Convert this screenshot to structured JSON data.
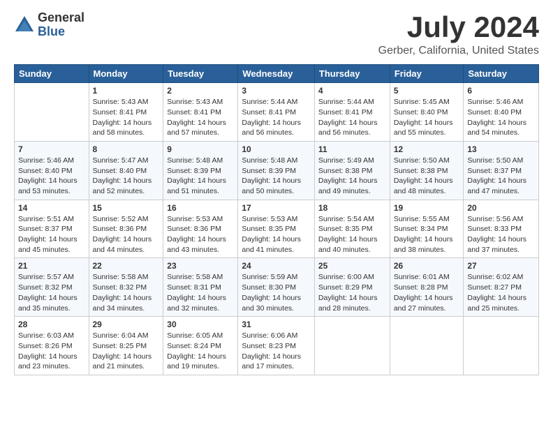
{
  "logo": {
    "general": "General",
    "blue": "Blue"
  },
  "title": "July 2024",
  "subtitle": "Gerber, California, United States",
  "days_of_week": [
    "Sunday",
    "Monday",
    "Tuesday",
    "Wednesday",
    "Thursday",
    "Friday",
    "Saturday"
  ],
  "weeks": [
    [
      {
        "day": "",
        "info": ""
      },
      {
        "day": "1",
        "info": "Sunrise: 5:43 AM\nSunset: 8:41 PM\nDaylight: 14 hours\nand 58 minutes."
      },
      {
        "day": "2",
        "info": "Sunrise: 5:43 AM\nSunset: 8:41 PM\nDaylight: 14 hours\nand 57 minutes."
      },
      {
        "day": "3",
        "info": "Sunrise: 5:44 AM\nSunset: 8:41 PM\nDaylight: 14 hours\nand 56 minutes."
      },
      {
        "day": "4",
        "info": "Sunrise: 5:44 AM\nSunset: 8:41 PM\nDaylight: 14 hours\nand 56 minutes."
      },
      {
        "day": "5",
        "info": "Sunrise: 5:45 AM\nSunset: 8:40 PM\nDaylight: 14 hours\nand 55 minutes."
      },
      {
        "day": "6",
        "info": "Sunrise: 5:46 AM\nSunset: 8:40 PM\nDaylight: 14 hours\nand 54 minutes."
      }
    ],
    [
      {
        "day": "7",
        "info": "Sunrise: 5:46 AM\nSunset: 8:40 PM\nDaylight: 14 hours\nand 53 minutes."
      },
      {
        "day": "8",
        "info": "Sunrise: 5:47 AM\nSunset: 8:40 PM\nDaylight: 14 hours\nand 52 minutes."
      },
      {
        "day": "9",
        "info": "Sunrise: 5:48 AM\nSunset: 8:39 PM\nDaylight: 14 hours\nand 51 minutes."
      },
      {
        "day": "10",
        "info": "Sunrise: 5:48 AM\nSunset: 8:39 PM\nDaylight: 14 hours\nand 50 minutes."
      },
      {
        "day": "11",
        "info": "Sunrise: 5:49 AM\nSunset: 8:38 PM\nDaylight: 14 hours\nand 49 minutes."
      },
      {
        "day": "12",
        "info": "Sunrise: 5:50 AM\nSunset: 8:38 PM\nDaylight: 14 hours\nand 48 minutes."
      },
      {
        "day": "13",
        "info": "Sunrise: 5:50 AM\nSunset: 8:37 PM\nDaylight: 14 hours\nand 47 minutes."
      }
    ],
    [
      {
        "day": "14",
        "info": "Sunrise: 5:51 AM\nSunset: 8:37 PM\nDaylight: 14 hours\nand 45 minutes."
      },
      {
        "day": "15",
        "info": "Sunrise: 5:52 AM\nSunset: 8:36 PM\nDaylight: 14 hours\nand 44 minutes."
      },
      {
        "day": "16",
        "info": "Sunrise: 5:53 AM\nSunset: 8:36 PM\nDaylight: 14 hours\nand 43 minutes."
      },
      {
        "day": "17",
        "info": "Sunrise: 5:53 AM\nSunset: 8:35 PM\nDaylight: 14 hours\nand 41 minutes."
      },
      {
        "day": "18",
        "info": "Sunrise: 5:54 AM\nSunset: 8:35 PM\nDaylight: 14 hours\nand 40 minutes."
      },
      {
        "day": "19",
        "info": "Sunrise: 5:55 AM\nSunset: 8:34 PM\nDaylight: 14 hours\nand 38 minutes."
      },
      {
        "day": "20",
        "info": "Sunrise: 5:56 AM\nSunset: 8:33 PM\nDaylight: 14 hours\nand 37 minutes."
      }
    ],
    [
      {
        "day": "21",
        "info": "Sunrise: 5:57 AM\nSunset: 8:32 PM\nDaylight: 14 hours\nand 35 minutes."
      },
      {
        "day": "22",
        "info": "Sunrise: 5:58 AM\nSunset: 8:32 PM\nDaylight: 14 hours\nand 34 minutes."
      },
      {
        "day": "23",
        "info": "Sunrise: 5:58 AM\nSunset: 8:31 PM\nDaylight: 14 hours\nand 32 minutes."
      },
      {
        "day": "24",
        "info": "Sunrise: 5:59 AM\nSunset: 8:30 PM\nDaylight: 14 hours\nand 30 minutes."
      },
      {
        "day": "25",
        "info": "Sunrise: 6:00 AM\nSunset: 8:29 PM\nDaylight: 14 hours\nand 28 minutes."
      },
      {
        "day": "26",
        "info": "Sunrise: 6:01 AM\nSunset: 8:28 PM\nDaylight: 14 hours\nand 27 minutes."
      },
      {
        "day": "27",
        "info": "Sunrise: 6:02 AM\nSunset: 8:27 PM\nDaylight: 14 hours\nand 25 minutes."
      }
    ],
    [
      {
        "day": "28",
        "info": "Sunrise: 6:03 AM\nSunset: 8:26 PM\nDaylight: 14 hours\nand 23 minutes."
      },
      {
        "day": "29",
        "info": "Sunrise: 6:04 AM\nSunset: 8:25 PM\nDaylight: 14 hours\nand 21 minutes."
      },
      {
        "day": "30",
        "info": "Sunrise: 6:05 AM\nSunset: 8:24 PM\nDaylight: 14 hours\nand 19 minutes."
      },
      {
        "day": "31",
        "info": "Sunrise: 6:06 AM\nSunset: 8:23 PM\nDaylight: 14 hours\nand 17 minutes."
      },
      {
        "day": "",
        "info": ""
      },
      {
        "day": "",
        "info": ""
      },
      {
        "day": "",
        "info": ""
      }
    ]
  ]
}
